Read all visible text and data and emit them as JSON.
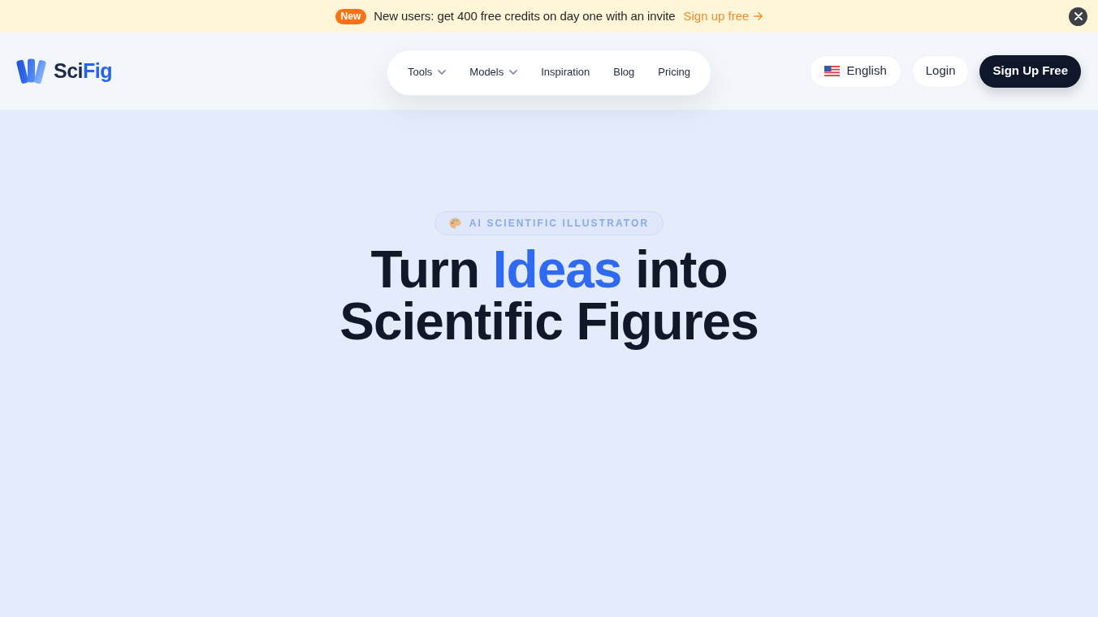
{
  "announcement": {
    "badge": "New",
    "message": "New users: get 400 free credits on day one with an invite",
    "link": "Sign up free"
  },
  "header": {
    "brand": [
      {
        "text": "Sci",
        "highlight": false
      },
      {
        "text": "Fig",
        "highlight": true
      }
    ],
    "nav": [
      {
        "label": "Tools",
        "has_menu": true
      },
      {
        "label": "Models",
        "has_menu": true
      },
      {
        "label": "Inspiration",
        "has_menu": false
      },
      {
        "label": "Blog",
        "has_menu": false
      },
      {
        "label": "Pricing",
        "has_menu": false
      }
    ],
    "language": "English",
    "login": "Login",
    "signup": "Sign Up Free"
  },
  "hero": {
    "badge": "AI SCIENTIFIC ILLUSTRATOR",
    "title": [
      {
        "text": "Turn ",
        "highlight": false
      },
      {
        "text": "Ideas",
        "highlight": true
      },
      {
        "text": " into Scientific Figures",
        "highlight": false
      }
    ]
  }
}
